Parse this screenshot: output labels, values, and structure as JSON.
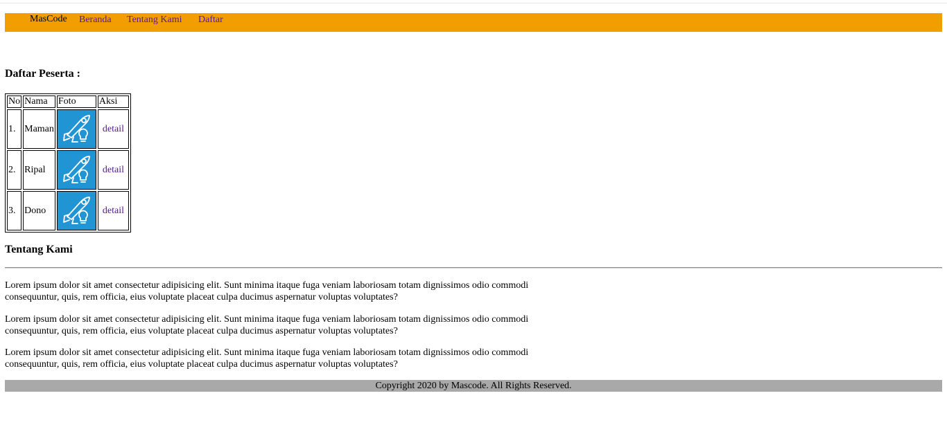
{
  "nav": {
    "brand": "MasCode",
    "links": [
      "Beranda",
      "Tentang Kami",
      "Daftar"
    ],
    "bg_color": "#f29e00",
    "link_color": "#551a8b"
  },
  "peserta": {
    "heading": "Daftar Peserta :",
    "columns": [
      "No",
      "Nama",
      "Foto",
      "Aksi"
    ],
    "rows": [
      {
        "no": "1.",
        "nama": "Maman",
        "foto": "rocket-icon",
        "aksi": "detail"
      },
      {
        "no": "2.",
        "nama": "Ripal",
        "foto": "rocket-icon",
        "aksi": "detail"
      },
      {
        "no": "3.",
        "nama": "Dono",
        "foto": "rocket-icon",
        "aksi": "detail"
      }
    ],
    "photo_bg": "#2195d4"
  },
  "about": {
    "heading": "Tentang Kami",
    "paragraphs": [
      "Lorem ipsum dolor sit amet consectetur adipisicing elit. Sunt minima itaque fuga veniam laboriosam totam dignissimos odio commodi consequuntur, quis, rem officia, eius voluptate placeat culpa ducimus aspernatur voluptas voluptates?",
      "Lorem ipsum dolor sit amet consectetur adipisicing elit. Sunt minima itaque fuga veniam laboriosam totam dignissimos odio commodi consequuntur, quis, rem officia, eius voluptate placeat culpa ducimus aspernatur voluptas voluptates?",
      "Lorem ipsum dolor sit amet consectetur adipisicing elit. Sunt minima itaque fuga veniam laboriosam totam dignissimos odio commodi consequuntur, quis, rem officia, eius voluptate placeat culpa ducimus aspernatur voluptas voluptates?"
    ]
  },
  "footer": {
    "text": "Copyright 2020 by Mascode. All Rights Reserved.",
    "bg_color": "#a9a9a9"
  }
}
